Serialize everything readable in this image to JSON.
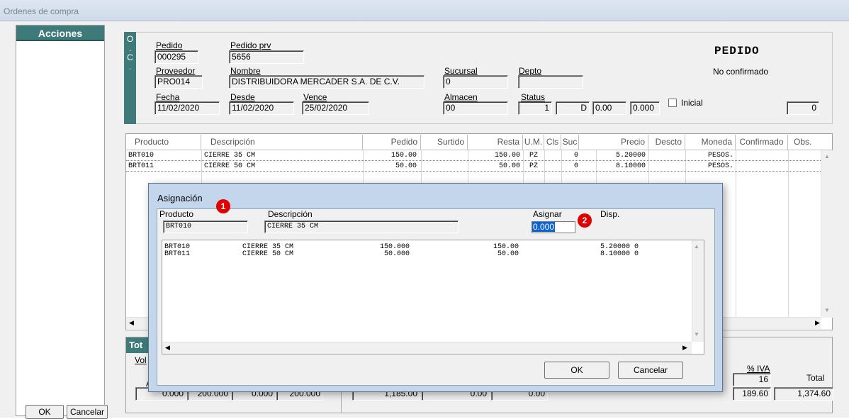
{
  "window": {
    "title": "Ordenes de compra"
  },
  "left_panel": {
    "title": "Acciones",
    "ok_label": "OK",
    "cancel_label": "Cancelar"
  },
  "side_strip": {
    "text": "O\n.\nC\n."
  },
  "header": {
    "pedido": {
      "label": "Pedido",
      "value": "000295"
    },
    "pedido_prv": {
      "label": "Pedido prv",
      "value": "5656"
    },
    "title": "PEDIDO",
    "status_text": "No confirmado",
    "proveedor": {
      "label": "Proveedor",
      "value": "PRO014"
    },
    "nombre": {
      "label": "Nombre",
      "value": "DISTRIBUIDORA MERCADER S.A. DE C.V."
    },
    "sucursal": {
      "label": "Sucursal",
      "value": "0"
    },
    "depto": {
      "label": "Depto",
      "value": ""
    },
    "fecha": {
      "label": "Fecha",
      "value": "11/02/2020"
    },
    "desde": {
      "label": "Desde",
      "value": "11/02/2020"
    },
    "vence": {
      "label": "Vence",
      "value": "25/02/2020"
    },
    "almacen": {
      "label": "Almacen",
      "value": "00"
    },
    "status": {
      "label": "Status",
      "value": "1"
    },
    "status_code": "D",
    "f1": "0.00",
    "f2": "0.000",
    "inicial_label": "Inicial",
    "right_count": "0"
  },
  "grid": {
    "columns": [
      "Producto",
      "Descripción",
      "Pedido",
      "Surtido",
      "Resta",
      "U.M.",
      "Cls",
      "Suc",
      "Precio",
      "Descto",
      "Moneda",
      "Confirmado",
      "Obs."
    ],
    "rows": [
      {
        "producto": "BRT010",
        "descripcion": "CIERRE 35 CM",
        "pedido": "150.00",
        "surtido": "",
        "resta": "150.00",
        "um": "PZ",
        "cls": "",
        "suc": "0",
        "precio": "5.20000",
        "descto": "",
        "moneda": "PESOS.",
        "confirmado": "",
        "obs": ""
      },
      {
        "producto": "BRT011",
        "descripcion": "CIERRE 50 CM",
        "pedido": "50.00",
        "surtido": "",
        "resta": "50.00",
        "um": "PZ",
        "cls": "",
        "suc": "0",
        "precio": "8.10000",
        "descto": "",
        "moneda": "PESOS.",
        "confirmado": "",
        "obs": ""
      }
    ]
  },
  "totals": {
    "title": "Tot",
    "vol_label": "Vol",
    "a_label": "A",
    "row": [
      "0.000",
      "200.000",
      "0.000",
      "200.000",
      "1,185.00",
      "0.00",
      "0.00"
    ],
    "iva_label": "% IVA",
    "iva_value": "16",
    "total_label": "Total",
    "iva_amount": "189.60",
    "total_value": "1,374.60"
  },
  "dialog": {
    "title": "Asignación",
    "producto": {
      "label": "Producto",
      "value": "BRT010"
    },
    "descripcion": {
      "label": "Descripción",
      "value": "CIERRE 35 CM"
    },
    "asignar": {
      "label": "Asignar",
      "value": "0.000"
    },
    "disp_label": "Disp.",
    "marker1": "1",
    "marker2": "2",
    "rows": [
      {
        "producto": "BRT010",
        "descripcion": "CIERRE 35 CM",
        "a": "150.000",
        "b": "150.00",
        "c": "5.20000 0"
      },
      {
        "producto": "BRT011",
        "descripcion": "CIERRE 50 CM",
        "a": "50.000",
        "b": "50.00",
        "c": "8.10000 0"
      }
    ],
    "ok_label": "OK",
    "cancel_label": "Cancelar"
  },
  "colors": {
    "teal": "#3e7a7a",
    "marker": "#e10000",
    "dialog_frame": "#c4d6ec"
  }
}
